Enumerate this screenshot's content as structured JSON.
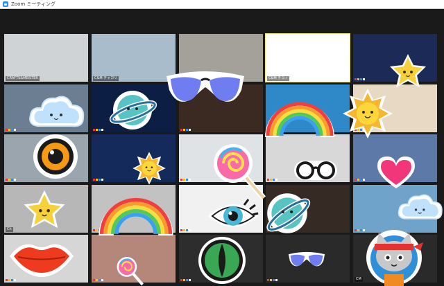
{
  "window": {
    "title": "Zoom ミーティング"
  },
  "tiles": [
    {
      "name": "CRAFTS&MEISTER",
      "bg": "#cfd3d6"
    },
    {
      "name": "C&M チャカリ",
      "bg": "#a9bccb"
    },
    {
      "name": "",
      "bg": "#a4a19a"
    },
    {
      "name": "C&M チヨノ",
      "bg": "#ffffff"
    },
    {
      "name": "",
      "bg": "#1b2a57"
    },
    {
      "name": "",
      "bg": "#6b7e92"
    },
    {
      "name": "",
      "bg": "#0d1e44"
    },
    {
      "name": "",
      "bg": "#3a2a22"
    },
    {
      "name": "",
      "bg": "#2f88c7"
    },
    {
      "name": "",
      "bg": "#e8d9c4"
    },
    {
      "name": "",
      "bg": "#9aa5ae"
    },
    {
      "name": "",
      "bg": "#142a5a"
    },
    {
      "name": "",
      "bg": "#dfe3e6"
    },
    {
      "name": "",
      "bg": "#d8d8d8"
    },
    {
      "name": "",
      "bg": "#5c79a8"
    },
    {
      "name": "Ch",
      "bg": "#b7b7b7"
    },
    {
      "name": "",
      "bg": "#c2c2c2"
    },
    {
      "name": "",
      "bg": "#f1f1f1"
    },
    {
      "name": "",
      "bg": "#362a24"
    },
    {
      "name": "",
      "bg": "#6fa3c9"
    },
    {
      "name": "",
      "bg": "#d6d6d6"
    },
    {
      "name": "",
      "bg": "#b5877a"
    },
    {
      "name": "",
      "bg": "#2d2d2d"
    },
    {
      "name": "",
      "bg": "#2a2a2a"
    },
    {
      "name": "CM",
      "bg": "#2a2a2a"
    }
  ],
  "stickers": {
    "sunglasses": "sunglasses-sticker",
    "star": "star-sticker",
    "cloud": "cloud-sticker",
    "planet": "planet-sticker",
    "rainbow": "rainbow-sticker",
    "sun": "sun-sticker",
    "eye": "eye-sticker",
    "lollipop": "lollipop-sticker",
    "glasses": "glasses-sticker",
    "heart": "heart-sticker",
    "lips": "lips-sticker",
    "cat_eye": "cat-eye-sticker",
    "ninja_cat": "ninja-cat-sticker"
  }
}
